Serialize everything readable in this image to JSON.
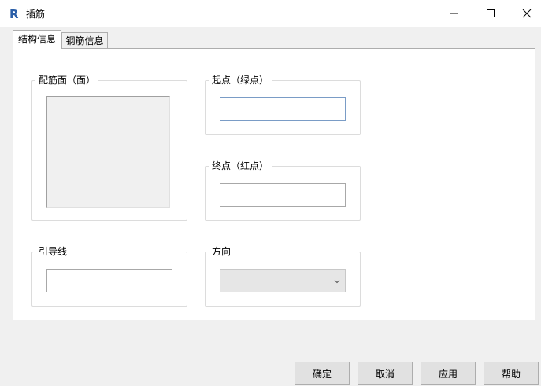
{
  "window": {
    "title": "插筋",
    "controls": {
      "minimize_icon": "minimize-icon",
      "maximize_icon": "maximize-icon",
      "close_icon": "close-icon"
    },
    "app_icon_letter": "R",
    "app_icon_color": "#2b5fa8"
  },
  "tabs": [
    {
      "label": "结构信息",
      "active": true
    },
    {
      "label": "钢筋信息",
      "active": false
    }
  ],
  "groups": {
    "face": {
      "label": "配筋面（面）"
    },
    "start": {
      "label": "起点（绿点）",
      "value": ""
    },
    "end": {
      "label": "终点（红点）",
      "value": ""
    },
    "leader": {
      "label": "引导线",
      "value": ""
    },
    "direction": {
      "label": "方向",
      "value": ""
    }
  },
  "buttons": {
    "ok": "确定",
    "cancel": "取消",
    "apply": "应用",
    "help": "帮助"
  }
}
